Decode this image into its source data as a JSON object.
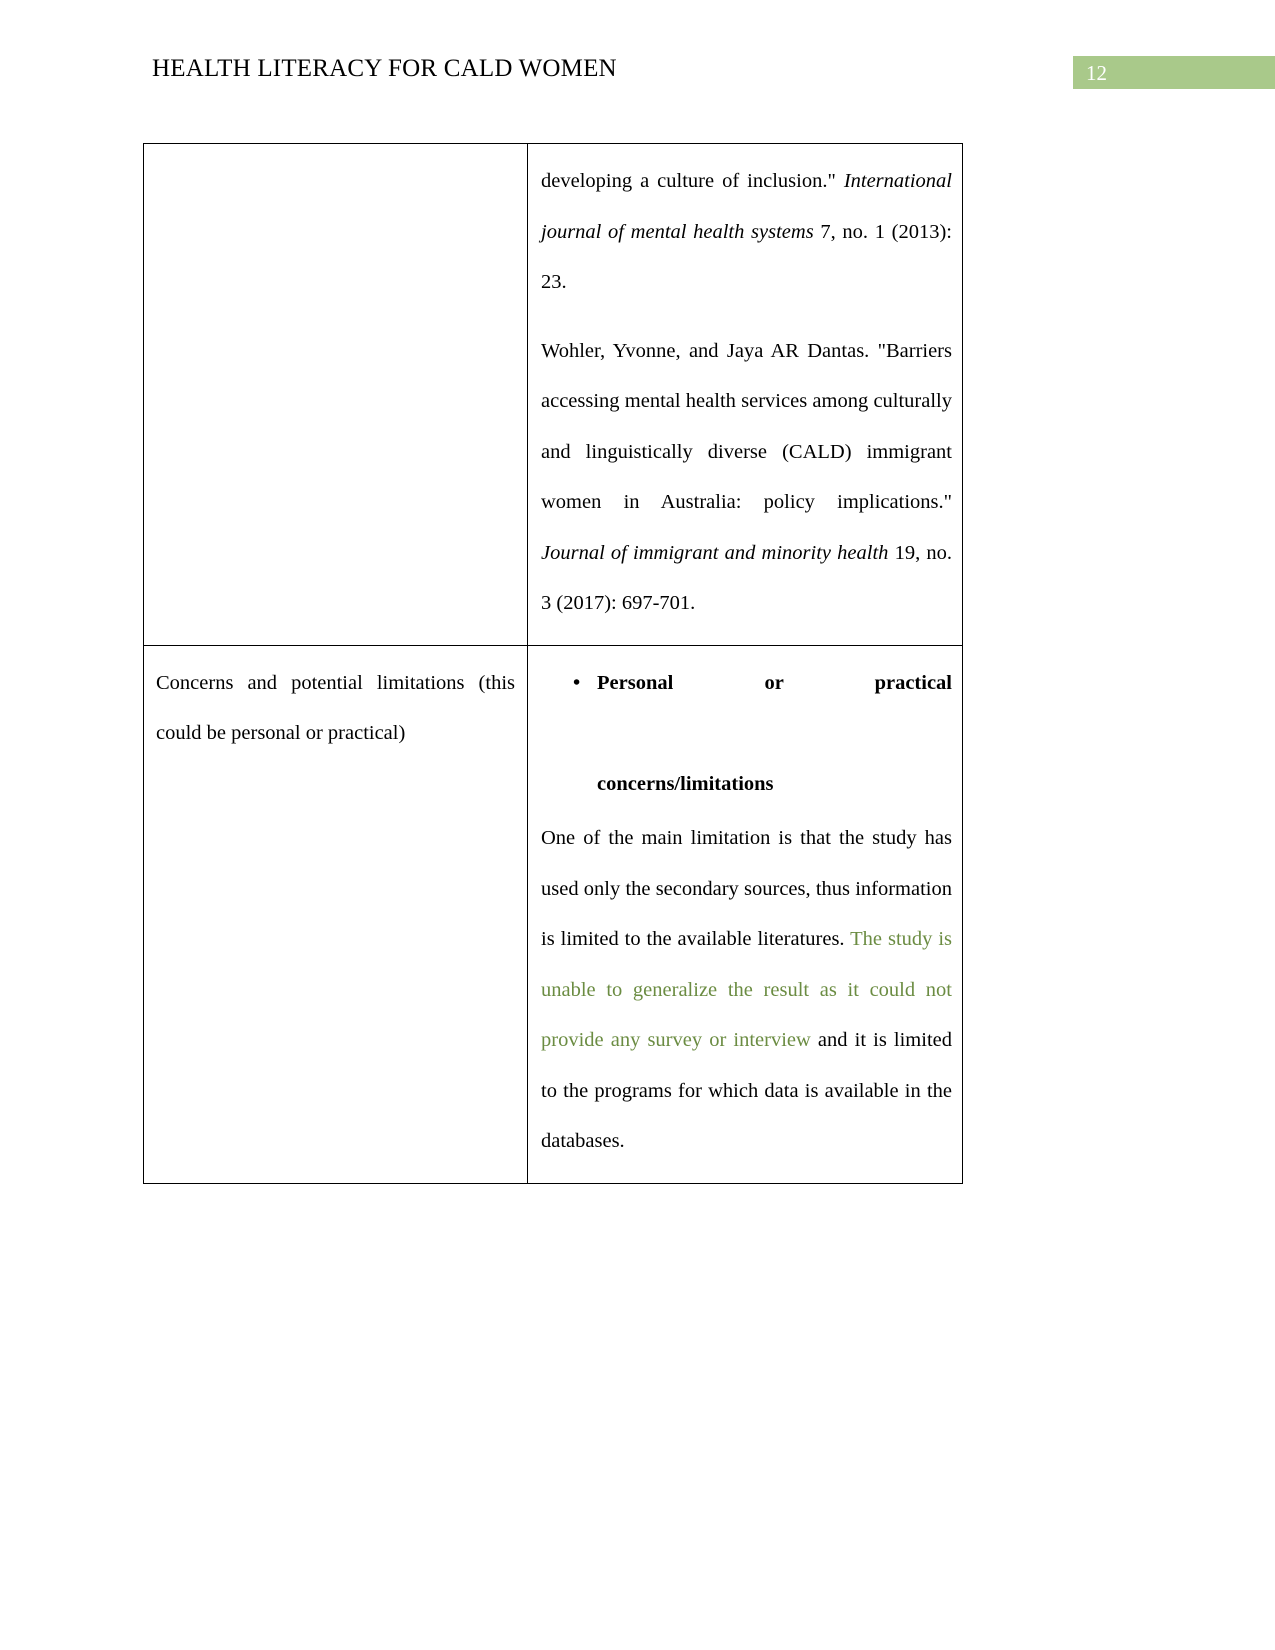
{
  "document": {
    "header_title": "HEALTH LITERACY FOR CALD WOMEN",
    "page_number": "12",
    "badge_color": "#a9c98a",
    "highlight_text_color": "#6b8c42"
  },
  "table": {
    "rows": [
      {
        "left_cell": {
          "text": ""
        },
        "right_cell": {
          "paragraphs": [
            {
              "segments": [
                {
                  "text": "developing a culture of inclusion.\" ",
                  "style": "normal"
                },
                {
                  "text": "International journal of mental health systems",
                  "style": "italic"
                },
                {
                  "text": " 7, no. 1 (2013): 23.",
                  "style": "normal"
                }
              ],
              "plain": "developing a culture of inclusion.\" International journal of mental health systems 7, no. 1 (2013): 23."
            },
            {
              "segments": [
                {
                  "text": "Wohler, Yvonne, and Jaya AR Dantas. \"Barriers accessing mental health services among culturally and linguistically diverse (CALD) immigrant women in Australia: policy implications.\" ",
                  "style": "normal"
                },
                {
                  "text": "Journal of immigrant and minority health",
                  "style": "italic"
                },
                {
                  "text": " 19, no. 3 (2017): 697-701.",
                  "style": "normal"
                }
              ],
              "plain": "Wohler, Yvonne, and Jaya AR Dantas. \"Barriers accessing mental health services among culturally and linguistically diverse (CALD) immigrant women in Australia: policy implications.\" Journal of immigrant and minority health 19, no. 3 (2017): 697-701."
            }
          ]
        }
      },
      {
        "left_cell": {
          "text": "Concerns and potential limitations (this could be personal or practical)"
        },
        "right_cell": {
          "bullet_heading_line1": "Personal or practical",
          "bullet_heading_line2": "concerns/limitations",
          "bullet_glyph": "•",
          "body_segments": [
            {
              "text": "One of the main limitation is that the study has used only the secondary sources, thus information is limited to the available literatures. ",
              "style": "normal"
            },
            {
              "text": "The study is unable to generalize the result as it could not provide any survey or interview",
              "style": "green"
            },
            {
              "text": " and it is limited to the programs for which data is available in the databases.",
              "style": "normal"
            }
          ],
          "body_plain": "One of the main limitation is that the study has used only the secondary sources, thus information is limited to the available literatures. The study is unable to generalize the result as it could not provide any survey or interview and it is limited to the programs for which data is available in the databases."
        }
      }
    ]
  }
}
